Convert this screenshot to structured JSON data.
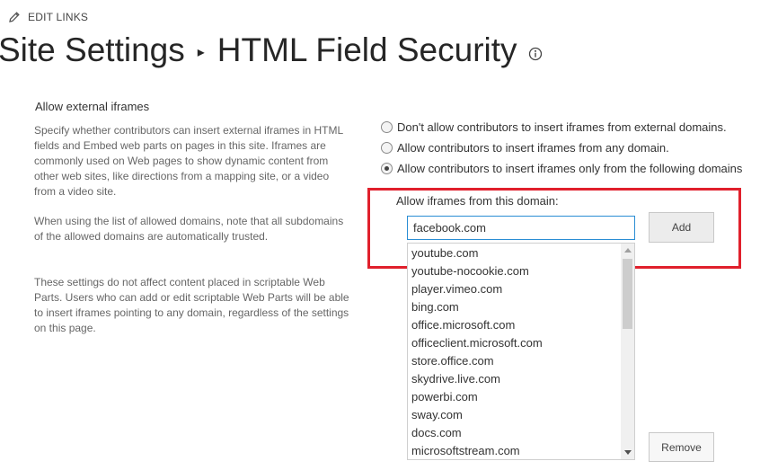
{
  "header": {
    "edit_links_label": "EDIT LINKS",
    "title_parent": "Site Settings",
    "title_separator": "▸",
    "title_page": "HTML Field Security"
  },
  "section": {
    "title": "Allow external iframes",
    "description_1": "Specify whether contributors can insert external iframes in HTML fields and Embed web parts on pages in this site. Iframes are commonly used on Web pages to show dynamic content from other web sites, like directions from a mapping site, or a video from a video site.",
    "description_2": "When using the list of allowed domains, note that all subdomains of the allowed domains are automatically trusted.",
    "description_3": "These settings do not affect content placed in scriptable Web Parts. Users who can add or edit scriptable Web Parts will be able to insert iframes pointing to any domain, regardless of the settings on this page."
  },
  "options": [
    {
      "label": "Don't allow contributors to insert iframes from external domains.",
      "checked": false
    },
    {
      "label": "Allow contributors to insert iframes from any domain.",
      "checked": false
    },
    {
      "label": "Allow contributors to insert iframes only from the following domains",
      "checked": true
    }
  ],
  "domains": {
    "label": "Allow iframes from this domain:",
    "input_value": "facebook.com",
    "add_label": "Add",
    "remove_label": "Remove",
    "list": [
      "youtube.com",
      "youtube-nocookie.com",
      "player.vimeo.com",
      "bing.com",
      "office.microsoft.com",
      "officeclient.microsoft.com",
      "store.office.com",
      "skydrive.live.com",
      "powerbi.com",
      "sway.com",
      "docs.com",
      "microsoftstream.com"
    ]
  },
  "colors": {
    "highlight": "#e0202c",
    "input_focus": "#2a8dd4"
  },
  "icons": {
    "edit": "pencil-icon",
    "info": "info-icon"
  }
}
